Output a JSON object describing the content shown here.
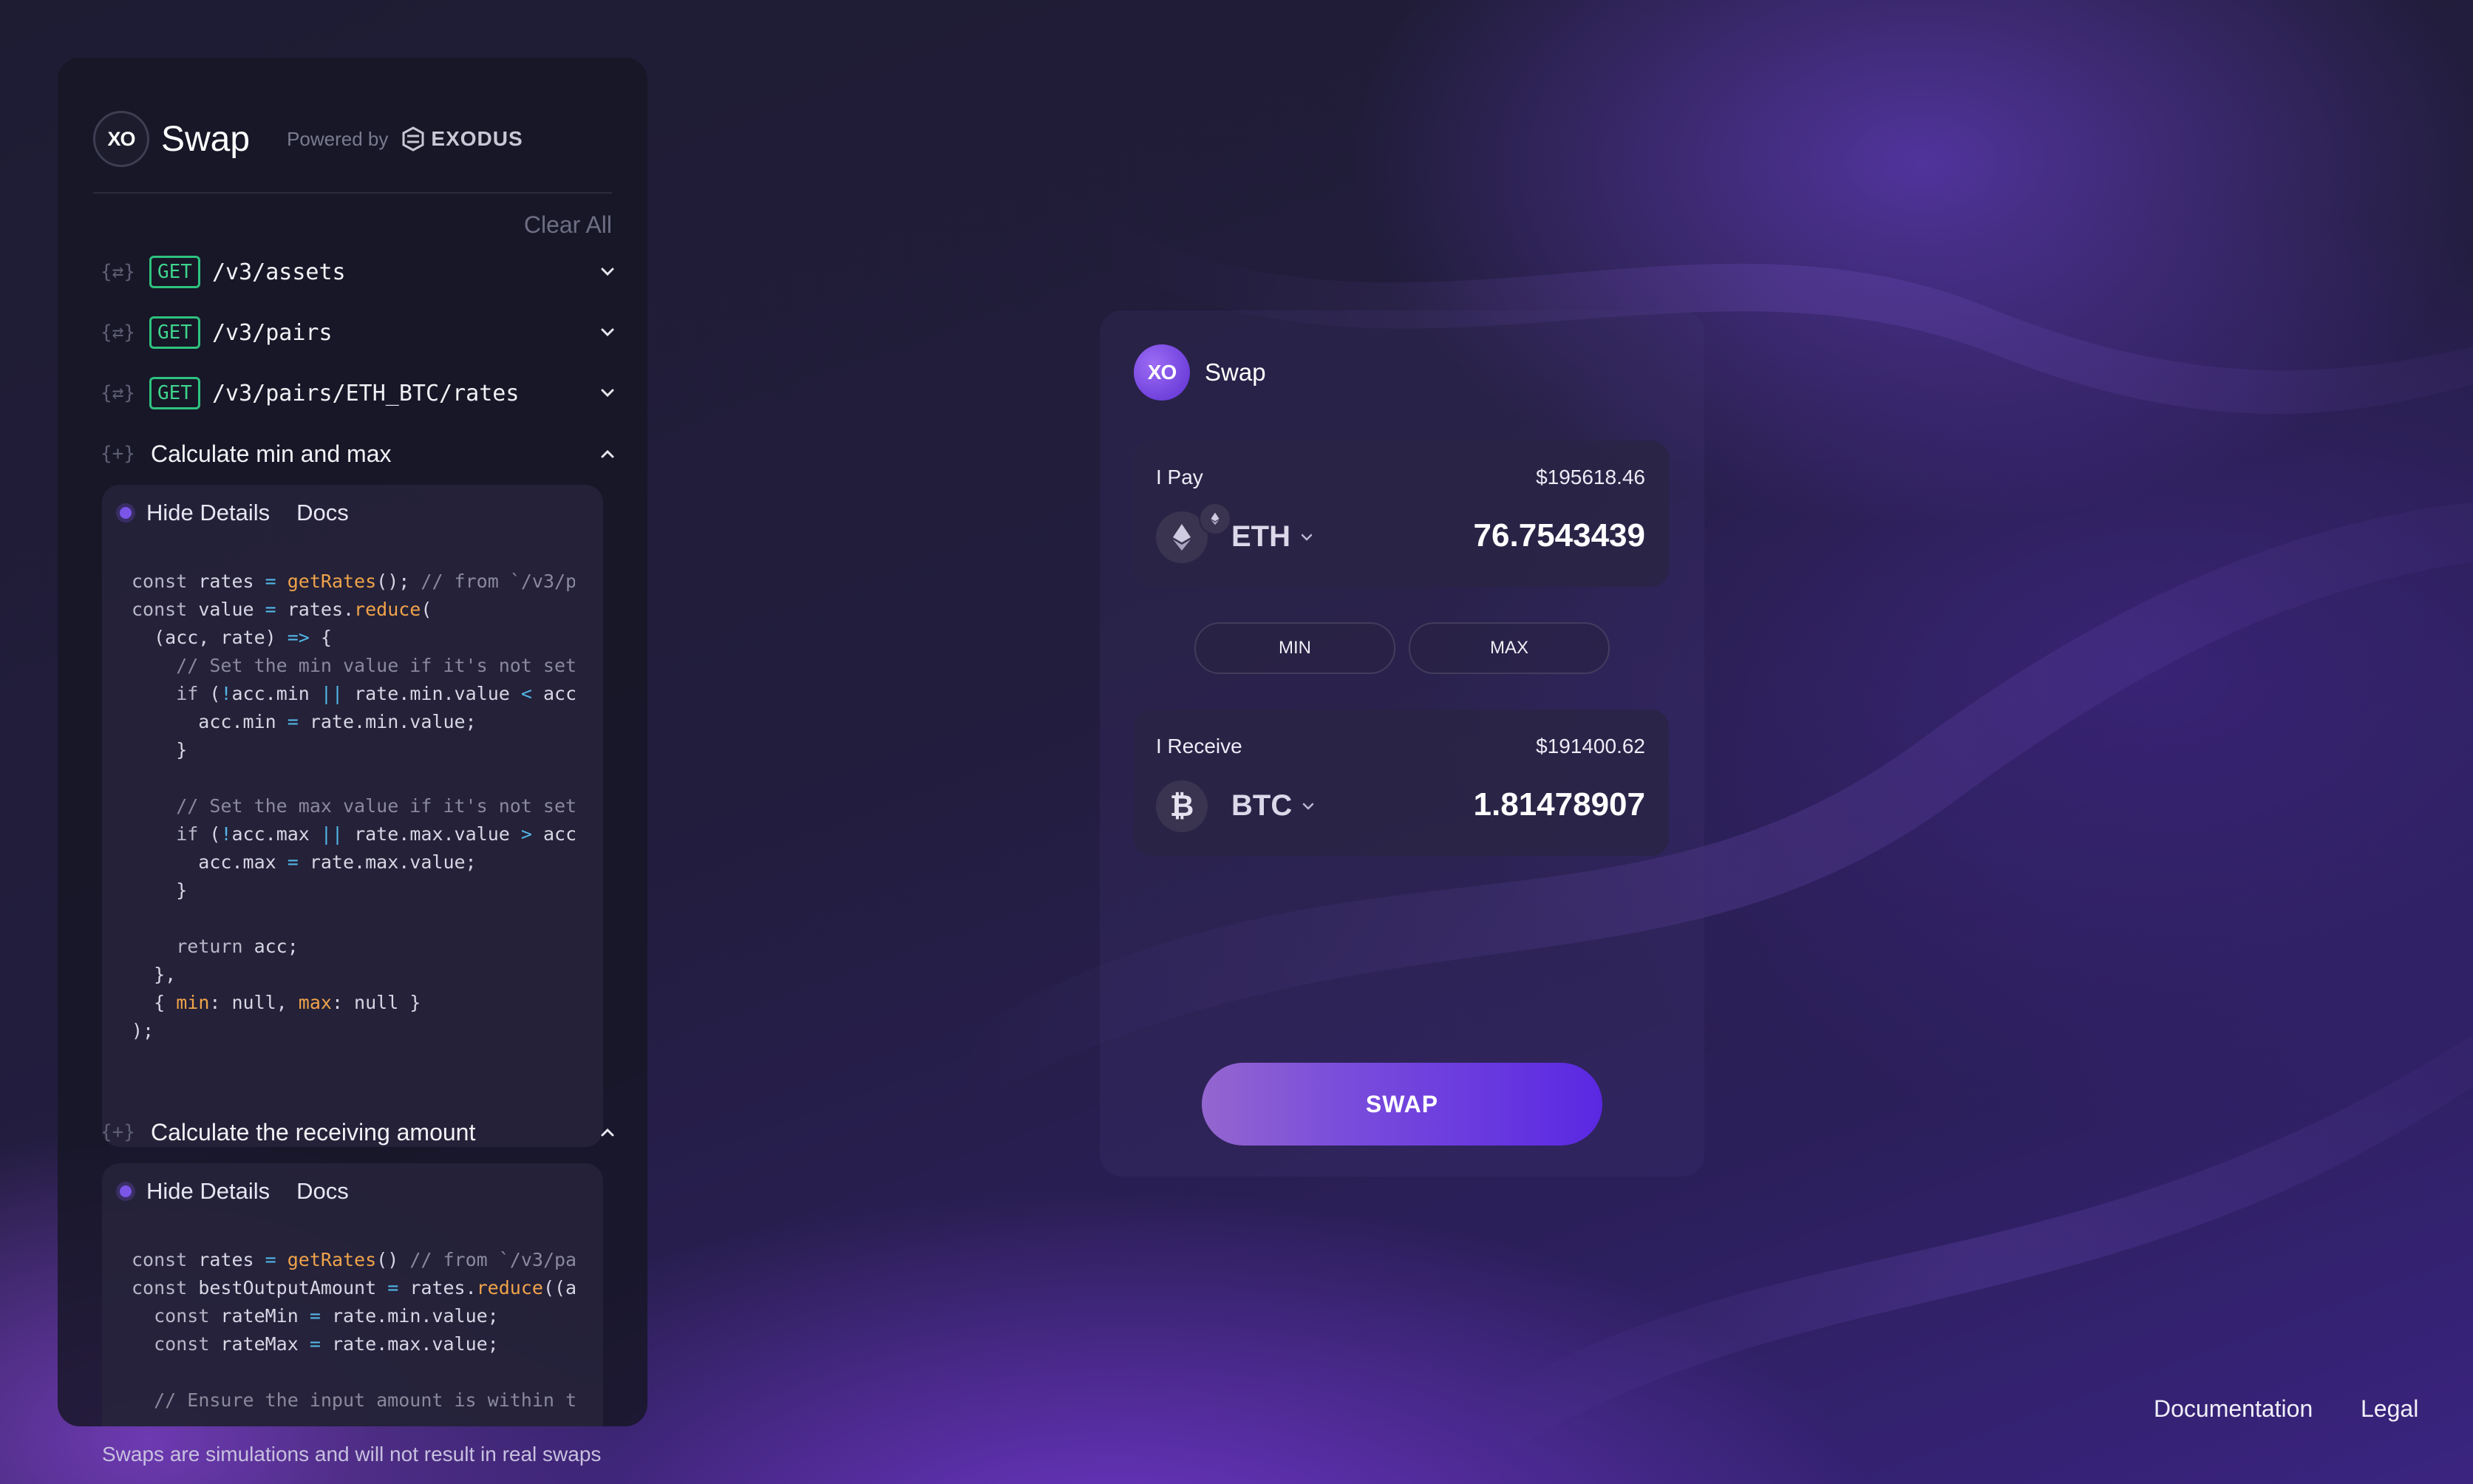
{
  "left_panel": {
    "app_title": "Swap",
    "logo_text": "XO",
    "powered_by": "Powered by",
    "brand_name": "EXODUS",
    "clear_all": "Clear All",
    "requests": [
      {
        "method": "GET",
        "path": "/v3/assets"
      },
      {
        "method": "GET",
        "path": "/v3/pairs"
      },
      {
        "method": "GET",
        "path": "/v3/pairs/ETH_BTC/rates"
      }
    ],
    "steps": [
      {
        "label": "Calculate min and max",
        "hide_details": "Hide Details",
        "docs": "Docs"
      },
      {
        "label": "Calculate the receiving amount",
        "hide_details": "Hide Details",
        "docs": "Docs"
      }
    ]
  },
  "disclaimer": "Swaps are simulations and will not result in real swaps",
  "swap_card": {
    "logo_text": "XO",
    "title": "Swap",
    "pay": {
      "label": "I Pay",
      "usd": "$195618.46",
      "ticker": "ETH",
      "amount": "76.7543439"
    },
    "receive": {
      "label": "I Receive",
      "usd": "$191400.62",
      "ticker": "BTC",
      "amount": "1.81478907"
    },
    "min_label": "MIN",
    "max_label": "MAX",
    "swap_label": "SWAP"
  },
  "footer": {
    "documentation": "Documentation",
    "legal": "Legal"
  },
  "colors": {
    "accent": "#5a28e2",
    "get_badge": "#2ec27e",
    "code_function": "#f0a34a",
    "code_operator": "#53b6e6"
  }
}
